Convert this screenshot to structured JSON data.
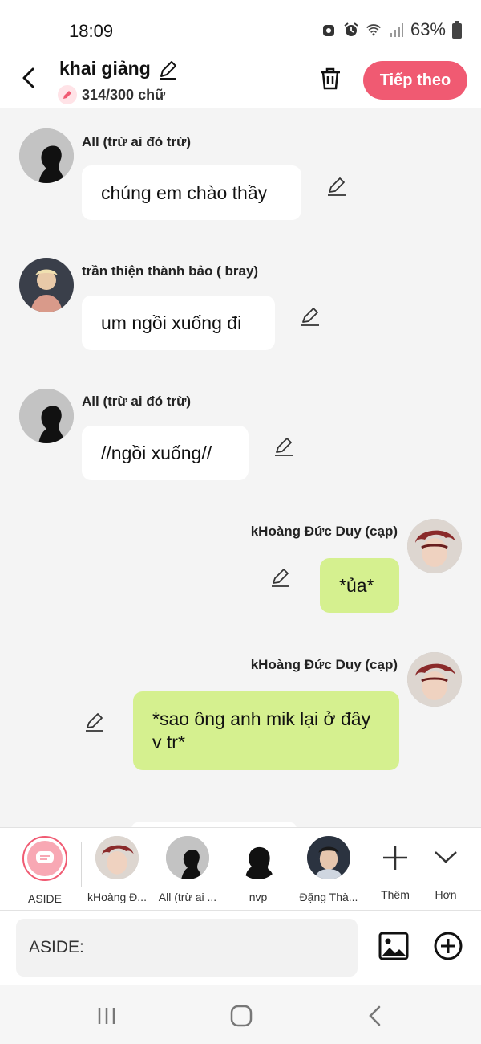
{
  "status_bar": {
    "time": "18:09",
    "battery": "63%"
  },
  "header": {
    "title": "khai giảng",
    "word_count": "314/300 chữ",
    "next_label": "Tiếp theo"
  },
  "messages": [
    {
      "sender": "All (trừ ai đó trừ)",
      "text": "chúng em chào thầy",
      "side": "left",
      "avatar": "silhouette"
    },
    {
      "sender": "trần thiện thành bảo ( bray)",
      "text": "um ngồi xuống đi",
      "side": "left",
      "avatar": "photo-bao"
    },
    {
      "sender": "All (trừ ai đó trừ)",
      "text": "//ngồi xuống//",
      "side": "left",
      "avatar": "silhouette"
    },
    {
      "sender": "kHoàng Đức Duy (cạp)",
      "text": "*ủa*",
      "side": "right",
      "avatar": "photo-duy"
    },
    {
      "sender": "kHoàng Đức Duy (cạp)",
      "text": "*sao ông anh mik lại ở đây v tr*",
      "side": "right",
      "avatar": "photo-duy"
    }
  ],
  "characters": [
    {
      "label": "ASIDE"
    },
    {
      "label": "kHoàng Đ..."
    },
    {
      "label": "All (trừ ai ..."
    },
    {
      "label": "nvp"
    },
    {
      "label": "Đặng Thà..."
    },
    {
      "label": "Thêm"
    },
    {
      "label": "Hơn"
    }
  ],
  "input": {
    "placeholder": "ASIDE:"
  },
  "colors": {
    "accent": "#f05a72",
    "my_bubble": "#d5f08f",
    "chat_bg": "#f4f4f4"
  }
}
